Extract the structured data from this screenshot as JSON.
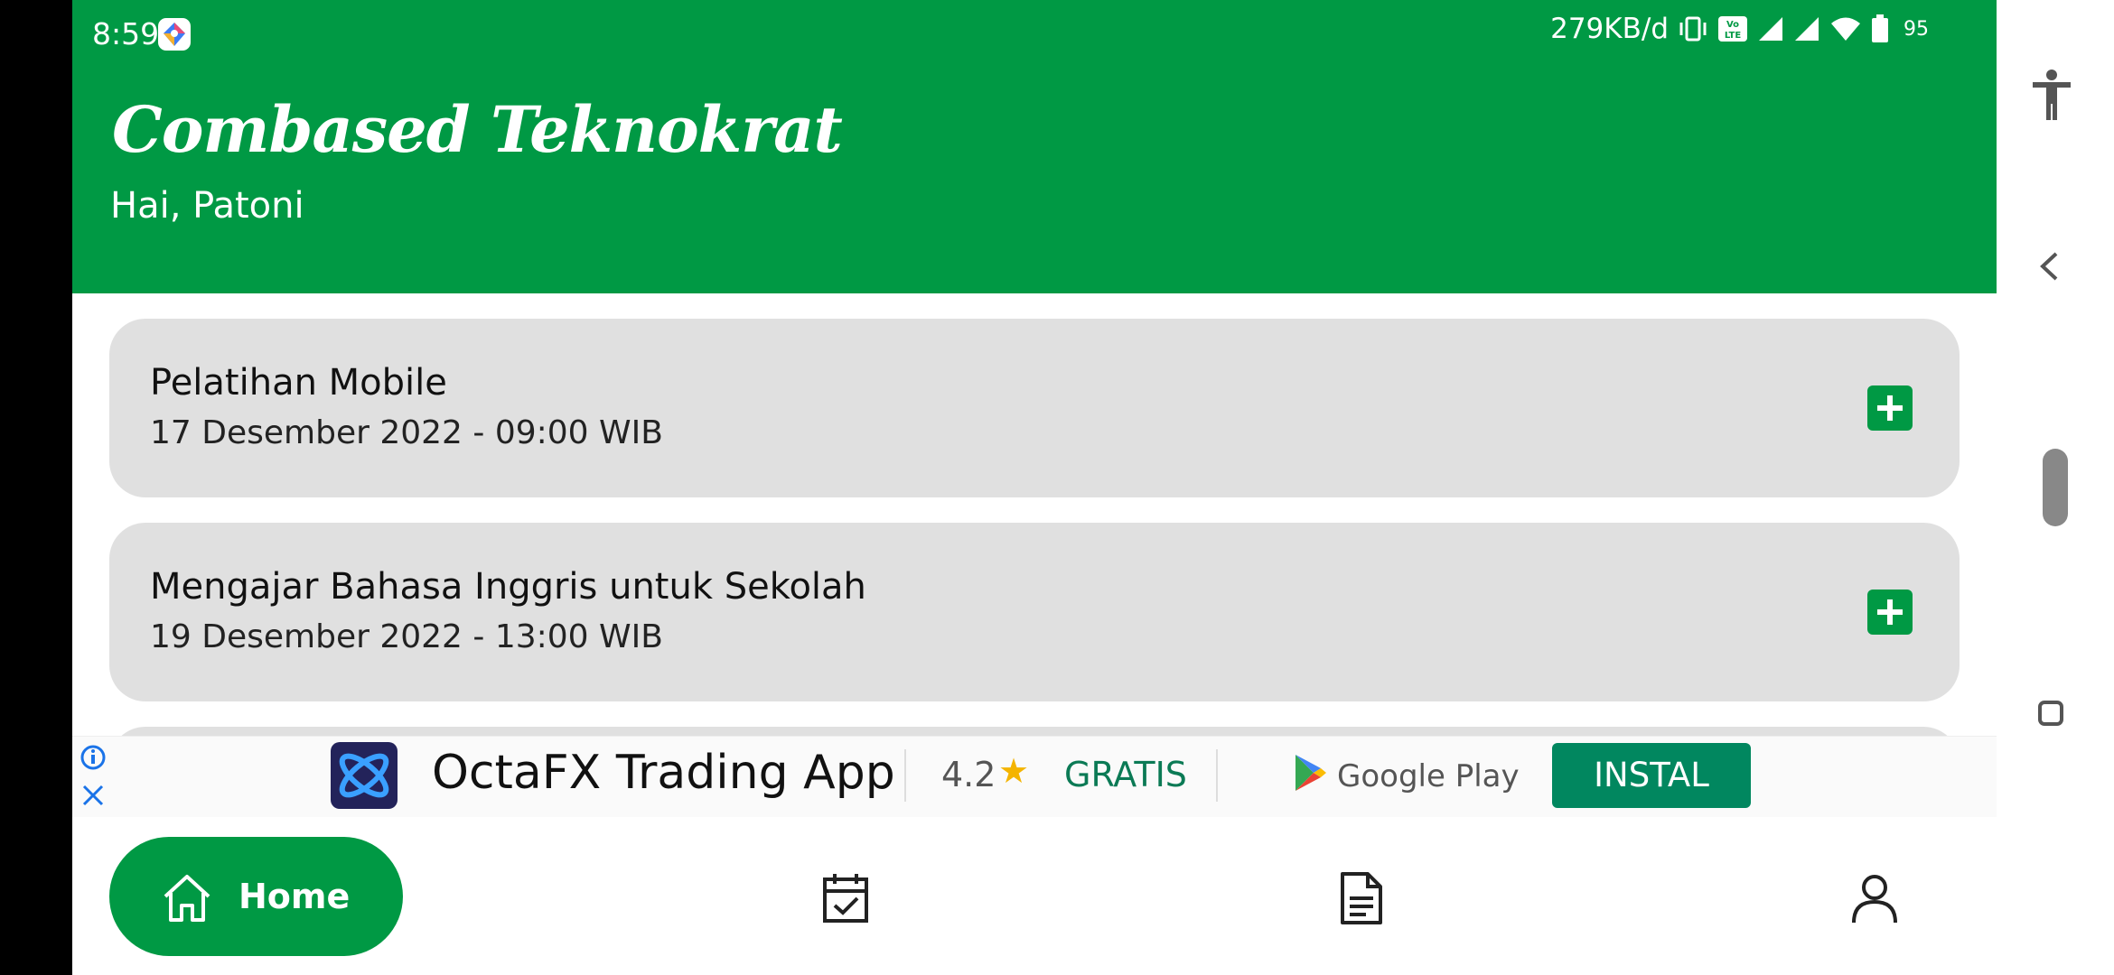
{
  "status_bar": {
    "time": "8:59",
    "net_speed": "279KB/d",
    "volte": "Vo LTE",
    "battery_percent": "95"
  },
  "header": {
    "app_title": "Combased Teknokrat",
    "greeting": "Hai, Patoni"
  },
  "events": [
    {
      "title": "Pelatihan Mobile",
      "date": "17 Desember 2022 - 09:00 WIB"
    },
    {
      "title": "Mengajar Bahasa Inggris untuk Sekolah",
      "date": "19 Desember 2022 - 13:00 WIB"
    }
  ],
  "ad": {
    "app_name": "OctaFX Trading App",
    "rating": "4.2",
    "star": "★",
    "price": "GRATIS",
    "store": "Google Play",
    "install_label": "INSTAL"
  },
  "bottom_nav": {
    "home_label": "Home",
    "items": [
      "home-icon",
      "calendar-check-icon",
      "document-icon",
      "profile-icon"
    ]
  },
  "colors": {
    "primary": "#009944",
    "card_bg": "#e0e0e0",
    "install_button": "#01875f"
  }
}
